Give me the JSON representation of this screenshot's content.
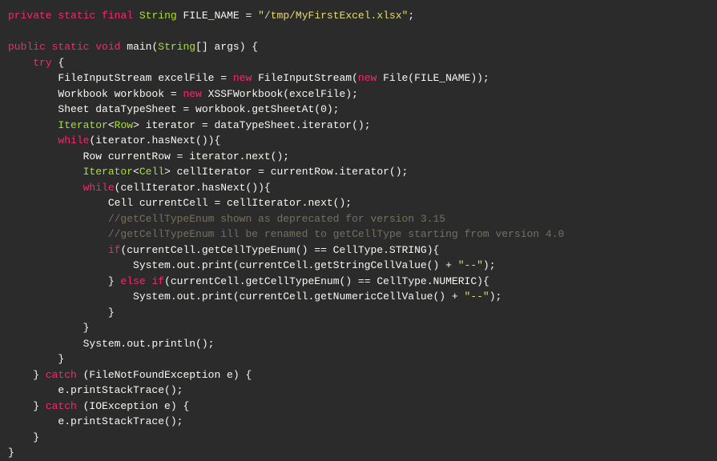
{
  "code": {
    "line1": {
      "kw1": "private",
      "kw2": "static",
      "kw3": "final",
      "type": "String",
      "rest": " FILE_NAME = ",
      "str": "\"/tmp/MyFirstExcel.xlsx\"",
      "end": ";"
    },
    "line3": {
      "kw1": "public",
      "kw2": "static",
      "kw3": "void",
      "rest1": " main(",
      "type": "String",
      "rest2": "[] args) {"
    },
    "line4": {
      "kw": "try",
      "rest": " {"
    },
    "line5": {
      "part1": "        FileInputStream excelFile = ",
      "kw1": "new",
      "part2": " FileInputStream(",
      "kw2": "new",
      "part3": " File(FILE_NAME));"
    },
    "line6": {
      "part1": "        Workbook workbook = ",
      "kw": "new",
      "part2": " XSSFWorkbook(excelFile);"
    },
    "line7": "        Sheet dataTypeSheet = workbook.getSheetAt(0);",
    "line8": {
      "type1": "Iterator",
      "lt": "<",
      "type2": "Row",
      "rest": "> iterator = dataTypeSheet.iterator();"
    },
    "line9": {
      "kw": "while",
      "rest": "(iterator.hasNext()){"
    },
    "line10": "            Row currentRow = iterator.next();",
    "line11": {
      "type1": "Iterator",
      "lt": "<",
      "type2": "Cell",
      "rest": "> cellIterator = currentRow.iterator();"
    },
    "line12": {
      "kw": "while",
      "rest": "(cellIterator.hasNext()){"
    },
    "line13": "                Cell currentCell = cellIterator.next();",
    "line14": "                //getCellTypeEnum shown as deprecated for version 3.15",
    "line15": "                //getCellTypeEnum ill be renamed to getCellType starting from version 4.0",
    "line16": {
      "kw": "if",
      "rest": "(currentCell.getCellTypeEnum() == CellType.STRING){"
    },
    "line17": {
      "part1": "                    System.out.print(currentCell.getStringCellValue() + ",
      "str": "\"--\"",
      "part2": ");"
    },
    "line18": {
      "part1": "                } ",
      "kw1": "else",
      "sp": " ",
      "kw2": "if",
      "rest": "(currentCell.getCellTypeEnum() == CellType.NUMERIC){"
    },
    "line19": {
      "part1": "                    System.out.print(currentCell.getNumericCellValue() + ",
      "str": "\"--\"",
      "part2": ");"
    },
    "line20": "                }",
    "line21": "            }",
    "line22": "            System.out.println();",
    "line23": "        }",
    "line24": {
      "part1": "    } ",
      "kw": "catch",
      "rest": " (FileNotFoundException e) {"
    },
    "line25": "        e.printStackTrace();",
    "line26": {
      "part1": "    } ",
      "kw": "catch",
      "rest": " (IOException e) {"
    },
    "line27": "        e.printStackTrace();",
    "line28": "    }",
    "line29": "}"
  }
}
